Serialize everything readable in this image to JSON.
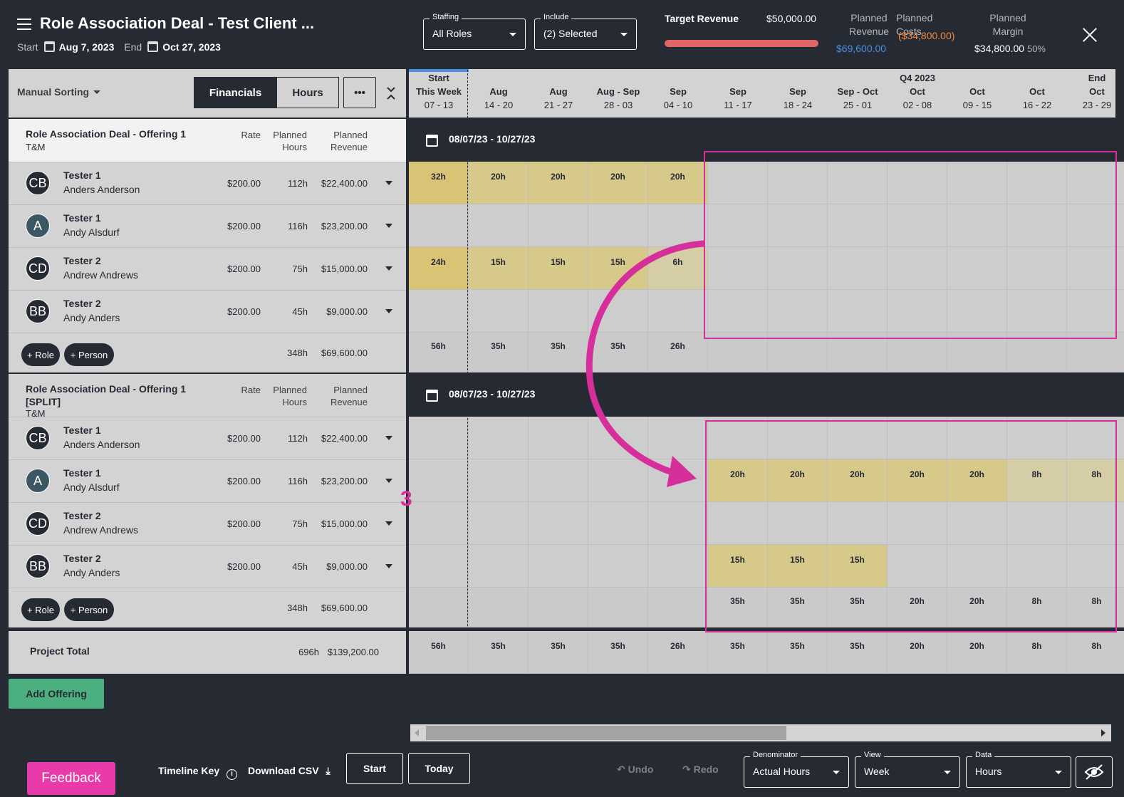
{
  "header": {
    "title": "Role Association Deal - Test Client ...",
    "start_label": "Start",
    "start_date": "Aug 7, 2023",
    "end_label": "End",
    "end_date": "Oct 27, 2023"
  },
  "filters": {
    "staffing_label": "Staffing",
    "staffing_value": "All Roles",
    "include_label": "Include",
    "include_value": "(2) Selected"
  },
  "financials": {
    "target_revenue_label": "Target Revenue",
    "target_revenue": "$50,000.00",
    "planned_revenue_label": "Planned Revenue",
    "planned_revenue": "$69,600.00",
    "planned_costs_label": "Planned Costs",
    "planned_costs": "($34,800.00)",
    "planned_margin_label": "Planned Margin",
    "planned_margin": "$34,800.00",
    "margin_pct": "50%",
    "bar_fill_fraction": 1.0
  },
  "toolbar": {
    "sorting": "Manual Sorting",
    "financials": "Financials",
    "hours": "Hours",
    "more": "•••"
  },
  "weeks": [
    {
      "top": "Start",
      "mid": "This Week",
      "bot": "07 - 13"
    },
    {
      "top": "",
      "mid": "Aug",
      "bot": "14 - 20"
    },
    {
      "top": "",
      "mid": "Aug",
      "bot": "21 - 27"
    },
    {
      "top": "",
      "mid": "Aug - Sep",
      "bot": "28 - 03"
    },
    {
      "top": "",
      "mid": "Sep",
      "bot": "04 - 10"
    },
    {
      "top": "",
      "mid": "Sep",
      "bot": "11 - 17"
    },
    {
      "top": "",
      "mid": "Sep",
      "bot": "18 - 24"
    },
    {
      "top": "",
      "mid": "Sep - Oct",
      "bot": "25 - 01"
    },
    {
      "top": "Q4 2023",
      "mid": "Oct",
      "bot": "02 - 08"
    },
    {
      "top": "",
      "mid": "Oct",
      "bot": "09 - 15"
    },
    {
      "top": "",
      "mid": "Oct",
      "bot": "16 - 22"
    },
    {
      "top": "End",
      "mid": "Oct",
      "bot": "23 - 29"
    }
  ],
  "columns": {
    "rate": "Rate",
    "hours": "Planned Hours",
    "revenue": "Planned Revenue"
  },
  "offerings": [
    {
      "title": "Role Association Deal - Offering 1",
      "type": "T&M",
      "range": "08/07/23 - 10/27/23",
      "total_hours": "348h",
      "total_revenue": "$69,600.00",
      "rows": [
        {
          "initials": "CB",
          "role": "Tester 1",
          "person": "Anders Anderson",
          "rate": "$200.00",
          "hours": "112h",
          "revenue": "$22,400.00",
          "cells": [
            "32h",
            "20h",
            "20h",
            "20h",
            "20h",
            "",
            "",
            "",
            "",
            "",
            "",
            ""
          ]
        },
        {
          "initials": "A",
          "role": "Tester 1",
          "person": "Andy Alsdurf",
          "rate": "$200.00",
          "hours": "116h",
          "revenue": "$23,200.00",
          "cells": [
            "",
            "",
            "",
            "",
            "",
            "",
            "",
            "",
            "",
            "",
            "",
            ""
          ]
        },
        {
          "initials": "CD",
          "role": "Tester 2",
          "person": "Andrew Andrews",
          "rate": "$200.00",
          "hours": "75h",
          "revenue": "$15,000.00",
          "cells": [
            "24h",
            "15h",
            "15h",
            "15h",
            "6h",
            "",
            "",
            "",
            "",
            "",
            "",
            ""
          ]
        },
        {
          "initials": "BB",
          "role": "Tester 2",
          "person": "Andy Anders",
          "rate": "$200.00",
          "hours": "45h",
          "revenue": "$9,000.00",
          "cells": [
            "",
            "",
            "",
            "",
            "",
            "",
            "",
            "",
            "",
            "",
            "",
            ""
          ]
        }
      ],
      "totals": [
        "56h",
        "35h",
        "35h",
        "35h",
        "26h",
        "",
        "",
        "",
        "",
        "",
        "",
        ""
      ]
    },
    {
      "title": "Role Association Deal - Offering 1",
      "title2": "[SPLIT]",
      "type": "T&M",
      "range": "08/07/23 - 10/27/23",
      "total_hours": "348h",
      "total_revenue": "$69,600.00",
      "rows": [
        {
          "initials": "CB",
          "role": "Tester 1",
          "person": "Anders Anderson",
          "rate": "$200.00",
          "hours": "112h",
          "revenue": "$22,400.00",
          "cells": [
            "",
            "",
            "",
            "",
            "",
            "",
            "",
            "",
            "",
            "",
            "",
            ""
          ]
        },
        {
          "initials": "A",
          "role": "Tester 1",
          "person": "Andy Alsdurf",
          "rate": "$200.00",
          "hours": "116h",
          "revenue": "$23,200.00",
          "cells": [
            "",
            "",
            "",
            "",
            "",
            "20h",
            "20h",
            "20h",
            "20h",
            "20h",
            "8h",
            "8h"
          ]
        },
        {
          "initials": "CD",
          "role": "Tester 2",
          "person": "Andrew Andrews",
          "rate": "$200.00",
          "hours": "75h",
          "revenue": "$15,000.00",
          "cells": [
            "",
            "",
            "",
            "",
            "",
            "",
            "",
            "",
            "",
            "",
            "",
            ""
          ]
        },
        {
          "initials": "BB",
          "role": "Tester 2",
          "person": "Andy Anders",
          "rate": "$200.00",
          "hours": "45h",
          "revenue": "$9,000.00",
          "cells": [
            "",
            "",
            "",
            "",
            "",
            "15h",
            "15h",
            "15h",
            "",
            "",
            "",
            ""
          ]
        }
      ],
      "totals": [
        "",
        "",
        "",
        "",
        "",
        "35h",
        "35h",
        "35h",
        "20h",
        "20h",
        "8h",
        "8h"
      ]
    }
  ],
  "add_role": "+ Role",
  "add_person": "+ Person",
  "project_total": {
    "label": "Project Total",
    "hours": "696h",
    "revenue": "$139,200.00",
    "cells": [
      "56h",
      "35h",
      "35h",
      "35h",
      "26h",
      "35h",
      "35h",
      "35h",
      "20h",
      "20h",
      "8h",
      "8h"
    ]
  },
  "add_offering": "Add Offering",
  "annotation": {
    "step": "3"
  },
  "footer": {
    "feedback": "Feedback",
    "timeline_key": "Timeline Key",
    "download_csv": "Download CSV",
    "start": "Start",
    "today": "Today",
    "undo": "Undo",
    "redo": "Redo",
    "denominator_label": "Denominator",
    "denominator_value": "Actual Hours",
    "view_label": "View",
    "view_value": "Week",
    "data_label": "Data",
    "data_value": "Hours"
  },
  "colors": {
    "accent": "#d62f9c",
    "bg": "#262a33",
    "revenue": "#4a90e2",
    "cost": "#f0883e",
    "add": "#4caf7f"
  }
}
